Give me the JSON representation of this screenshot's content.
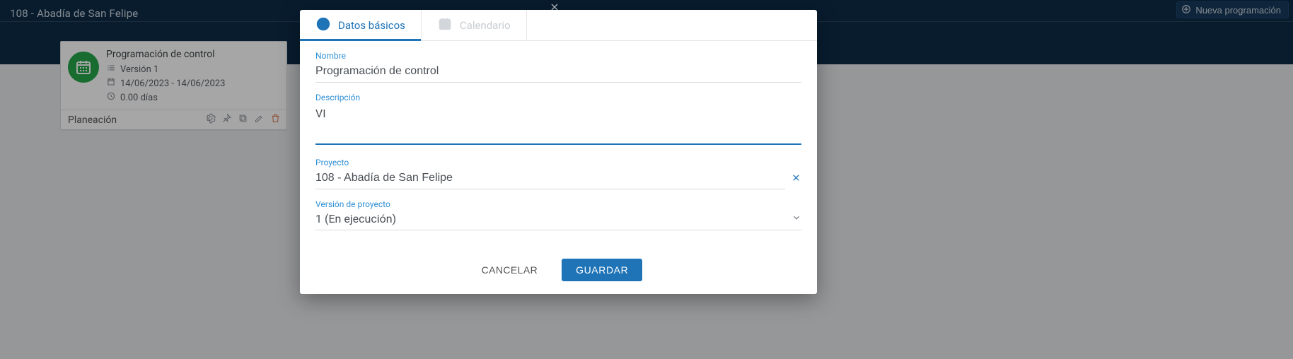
{
  "header": {
    "breadcrumb": "108 - Abadía de San Felipe",
    "new_btn_label": "Nueva programación"
  },
  "card": {
    "title": "Programación de control",
    "version_label": "Versión 1",
    "date_range": "14/06/2023 - 14/06/2023",
    "duration": "0.00 días",
    "footer_label": "Planeación"
  },
  "modal": {
    "tabs": {
      "basic": "Datos básicos",
      "calendar": "Calendario"
    },
    "fields": {
      "nombre_label": "Nombre",
      "nombre_value": "Programación de control",
      "descripcion_label": "Descripción",
      "descripcion_value": "VI",
      "proyecto_label": "Proyecto",
      "proyecto_value": "108 - Abadía de San Felipe",
      "version_label": "Versión de proyecto",
      "version_value": "1 (En ejecución)"
    },
    "buttons": {
      "cancel": "CANCELAR",
      "save": "GUARDAR"
    }
  }
}
